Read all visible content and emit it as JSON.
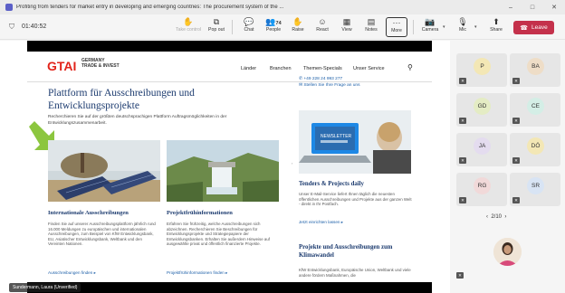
{
  "window": {
    "title": "Profiting from tenders for market entry in developing and emerging countries: The procurement system of the ...",
    "controls": [
      "–",
      "□",
      "✕"
    ]
  },
  "meeting": {
    "elapsed": "01:40:52",
    "toolbar": [
      {
        "label": "Take control",
        "icon": "take-control-icon",
        "enabled": false
      },
      {
        "label": "Pop out",
        "icon": "pop-out-icon",
        "enabled": true
      },
      {
        "label": "Chat",
        "icon": "chat-icon",
        "enabled": true
      },
      {
        "label": "People",
        "icon": "people-icon",
        "count": "74",
        "enabled": true
      },
      {
        "label": "Raise",
        "icon": "raise-hand-icon",
        "enabled": true
      },
      {
        "label": "React",
        "icon": "react-icon",
        "enabled": true
      },
      {
        "label": "View",
        "icon": "view-icon",
        "enabled": true
      },
      {
        "label": "Notes",
        "icon": "notes-icon",
        "enabled": true
      },
      {
        "label": "More",
        "icon": "more-icon",
        "enabled": true
      },
      {
        "label": "Camera",
        "icon": "camera-off-icon",
        "enabled": true
      },
      {
        "label": "Mic",
        "icon": "mic-off-icon",
        "enabled": true
      },
      {
        "label": "Share",
        "icon": "share-icon",
        "enabled": true
      }
    ],
    "leave_label": "Leave",
    "accent_leave": "#c4314b",
    "presenter_name": "Sundermann, Laura (Unverified)"
  },
  "website": {
    "logo_main": "GTAI",
    "logo_sub_1": "GERMANY",
    "logo_sub_2": "TRADE & INVEST",
    "nav": [
      "Länder",
      "Branchen",
      "Themen-Specials",
      "Unser Service"
    ],
    "headline": "Plattform für Ausschreibungen und Entwicklungsprojekte",
    "intro": "Recherchieren Sie auf der größten deutschsprachigen Plattform Auftragsmöglichkeiten in der Entwicklungszusammenarbeit.",
    "contact_phone": "+49 228 24 993 277",
    "contact_link": "Stellen Sie Ihre Frage an uns",
    "cards": [
      {
        "title": "Internationale Ausschreibungen",
        "text": "Finden Sie auf unserer Ausschreibungsplattform jährlich rund 16.000 Meldungen zu europäischen und internationalen Ausschreibungen, zum Beispiel von KfW Entwicklungsbank, EU, Asiatischer Entwicklungsbank, Weltbank und den Vereinten Nationen.",
        "link": "Ausschreibungen finden"
      },
      {
        "title": "Projektfrühinformationen",
        "text": "Erfahren Sie frühzeitig, welche Ausschreibungen sich abzeichnen. Recherchieren Sie Beschreibungen für Entwicklungsprojekte und Strategiepapiere der Entwicklungsbanken. Erhalten Sie außerdem Hinweise auf ausgewählte privat und öffentlich finanzierte Projekte.",
        "link": "Projektfrühinformationen finden"
      }
    ],
    "right_sections": [
      {
        "title": "Tenders & Projects daily",
        "text": "Unser E-Mail-Service liefert Ihnen täglich die neuesten öffentlichen Ausschreibungen und Projekte aus der ganzen Welt - direkt in Ihr Postfach.",
        "link": "Jetzt einrichten lassen"
      },
      {
        "title": "Projekte und Ausschreibungen zum Klimawandel",
        "text": "KfW Entwicklungsbank, Europäische Union, Weltbank und viele andere fördern Maßnahmen, die"
      }
    ],
    "newsletter_label": "NEWSLETTER"
  },
  "participants": {
    "tiles": [
      {
        "initials": "P",
        "color": "#f3e7b5"
      },
      {
        "initials": "BA",
        "color": "#eeddc7"
      },
      {
        "initials": "GD",
        "color": "#e4ecc4"
      },
      {
        "initials": "CE",
        "color": "#d4eee6"
      },
      {
        "initials": "JA",
        "color": "#e4dcef"
      },
      {
        "initials": "DÖ",
        "color": "#f3e7b5"
      },
      {
        "initials": "RG",
        "color": "#f1d9d9"
      },
      {
        "initials": "SR",
        "color": "#d8e4f4"
      }
    ],
    "page_indicator": "2/10",
    "prev": "‹",
    "next": "›"
  }
}
